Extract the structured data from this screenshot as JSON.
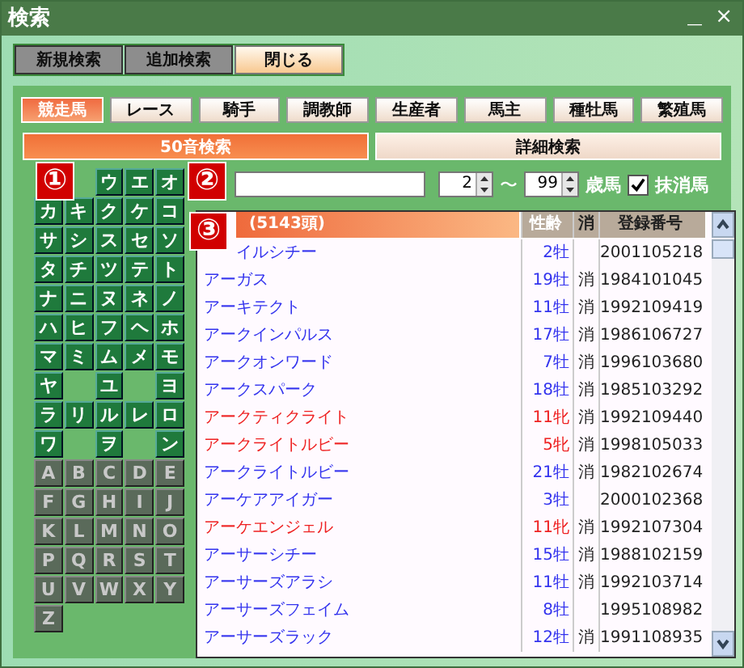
{
  "window": {
    "title": "検索",
    "controls": [
      "＿",
      "×"
    ]
  },
  "toolbar": [
    {
      "label": "新規検索",
      "selected": false
    },
    {
      "label": "追加検索",
      "selected": false
    },
    {
      "label": "閉じる",
      "selected": true
    }
  ],
  "tabs": [
    {
      "label": "競走馬",
      "selected": true
    },
    {
      "label": "レース",
      "selected": false
    },
    {
      "label": "騎手",
      "selected": false
    },
    {
      "label": "調教師",
      "selected": false
    },
    {
      "label": "生産者",
      "selected": false
    },
    {
      "label": "馬主",
      "selected": false
    },
    {
      "label": "種牡馬",
      "selected": false
    },
    {
      "label": "繁殖馬",
      "selected": false
    }
  ],
  "subtabs": [
    {
      "label": "50音検索",
      "selected": true
    },
    {
      "label": "詳細検索",
      "selected": false
    }
  ],
  "badges": [
    {
      "text": "①"
    },
    {
      "text": "②"
    },
    {
      "text": "③"
    }
  ],
  "kana_keys": [
    [
      {
        "kind": "covered"
      },
      {
        "kind": "covered"
      },
      {
        "kind": "kana",
        "label": "ウ"
      },
      {
        "kind": "kana",
        "label": "エ"
      },
      {
        "kind": "kana",
        "label": "オ"
      }
    ],
    [
      {
        "kind": "kana",
        "label": "カ"
      },
      {
        "kind": "kana",
        "label": "キ"
      },
      {
        "kind": "kana",
        "label": "ク"
      },
      {
        "kind": "kana",
        "label": "ケ"
      },
      {
        "kind": "kana",
        "label": "コ"
      }
    ],
    [
      {
        "kind": "kana",
        "label": "サ"
      },
      {
        "kind": "kana",
        "label": "シ"
      },
      {
        "kind": "kana",
        "label": "ス"
      },
      {
        "kind": "kana",
        "label": "セ"
      },
      {
        "kind": "kana",
        "label": "ソ"
      }
    ],
    [
      {
        "kind": "kana",
        "label": "タ"
      },
      {
        "kind": "kana",
        "label": "チ"
      },
      {
        "kind": "kana",
        "label": "ツ"
      },
      {
        "kind": "kana",
        "label": "テ"
      },
      {
        "kind": "kana",
        "label": "ト"
      }
    ],
    [
      {
        "kind": "kana",
        "label": "ナ"
      },
      {
        "kind": "kana",
        "label": "ニ"
      },
      {
        "kind": "kana",
        "label": "ヌ"
      },
      {
        "kind": "kana",
        "label": "ネ"
      },
      {
        "kind": "kana",
        "label": "ノ"
      }
    ],
    [
      {
        "kind": "kana",
        "label": "ハ"
      },
      {
        "kind": "kana",
        "label": "ヒ"
      },
      {
        "kind": "kana",
        "label": "フ"
      },
      {
        "kind": "kana",
        "label": "ヘ"
      },
      {
        "kind": "kana",
        "label": "ホ"
      }
    ],
    [
      {
        "kind": "kana",
        "label": "マ"
      },
      {
        "kind": "kana",
        "label": "ミ"
      },
      {
        "kind": "kana",
        "label": "ム"
      },
      {
        "kind": "kana",
        "label": "メ"
      },
      {
        "kind": "kana",
        "label": "モ"
      }
    ],
    [
      {
        "kind": "kana",
        "label": "ヤ"
      },
      {
        "kind": "gap"
      },
      {
        "kind": "kana",
        "label": "ユ"
      },
      {
        "kind": "gap"
      },
      {
        "kind": "kana",
        "label": "ヨ"
      }
    ],
    [
      {
        "kind": "kana",
        "label": "ラ"
      },
      {
        "kind": "kana",
        "label": "リ"
      },
      {
        "kind": "kana",
        "label": "ル"
      },
      {
        "kind": "kana",
        "label": "レ"
      },
      {
        "kind": "kana",
        "label": "ロ"
      }
    ],
    [
      {
        "kind": "kana",
        "label": "ワ"
      },
      {
        "kind": "gap"
      },
      {
        "kind": "kana",
        "label": "ヲ"
      },
      {
        "kind": "gap"
      },
      {
        "kind": "kana",
        "label": "ン"
      }
    ],
    [
      {
        "kind": "latin",
        "label": "A"
      },
      {
        "kind": "latin",
        "label": "B"
      },
      {
        "kind": "latin",
        "label": "C"
      },
      {
        "kind": "latin",
        "label": "D"
      },
      {
        "kind": "latin",
        "label": "E"
      }
    ],
    [
      {
        "kind": "latin",
        "label": "F"
      },
      {
        "kind": "latin",
        "label": "G"
      },
      {
        "kind": "latin",
        "label": "H"
      },
      {
        "kind": "latin",
        "label": "I"
      },
      {
        "kind": "latin",
        "label": "J"
      }
    ],
    [
      {
        "kind": "latin",
        "label": "K"
      },
      {
        "kind": "latin",
        "label": "L"
      },
      {
        "kind": "latin",
        "label": "M"
      },
      {
        "kind": "latin",
        "label": "N"
      },
      {
        "kind": "latin",
        "label": "O"
      }
    ],
    [
      {
        "kind": "latin",
        "label": "P"
      },
      {
        "kind": "latin",
        "label": "Q"
      },
      {
        "kind": "latin",
        "label": "R"
      },
      {
        "kind": "latin",
        "label": "S"
      },
      {
        "kind": "latin",
        "label": "T"
      }
    ],
    [
      {
        "kind": "latin",
        "label": "U"
      },
      {
        "kind": "latin",
        "label": "V"
      },
      {
        "kind": "latin",
        "label": "W"
      },
      {
        "kind": "latin",
        "label": "X"
      },
      {
        "kind": "latin",
        "label": "Y"
      }
    ],
    [
      {
        "kind": "latin",
        "label": "Z"
      }
    ]
  ],
  "filters": {
    "age_from": "2",
    "range_sign": "〜",
    "age_to": "99",
    "age_unit": "歳馬",
    "retired_checkbox": {
      "label": "抹消馬",
      "checked": true
    }
  },
  "table": {
    "columns": [
      "(5143頭)",
      "性齢",
      "消",
      "登録番号"
    ],
    "rows": [
      {
        "name": "イルシチー",
        "age_sex": "2牡",
        "reg_no": "2001105218",
        "color": "#3333ee"
      },
      {
        "name": "アーガス",
        "age_sex": "19牡",
        "retired": "消",
        "reg_no": "1984101045",
        "color": "#3333ee"
      },
      {
        "name": "アーキテクト",
        "age_sex": "11牡",
        "retired": "消",
        "reg_no": "1992109419",
        "color": "#3333ee"
      },
      {
        "name": "アークインパルス",
        "age_sex": "17牡",
        "retired": "消",
        "reg_no": "1986106727",
        "color": "#3333ee"
      },
      {
        "name": "アークオンワード",
        "age_sex": "7牡",
        "retired": "消",
        "reg_no": "1996103680",
        "color": "#3333ee"
      },
      {
        "name": "アークスパーク",
        "age_sex": "18牡",
        "retired": "消",
        "reg_no": "1985103292",
        "color": "#3333ee"
      },
      {
        "name": "アークティクライト",
        "age_sex": "11牝",
        "retired": "消",
        "reg_no": "1992109440",
        "color": "#ee2222"
      },
      {
        "name": "アークライトルビー",
        "age_sex": "5牝",
        "retired": "消",
        "reg_no": "1998105033",
        "color": "#ee2222"
      },
      {
        "name": "アークライトルビー",
        "age_sex": "21牡",
        "retired": "消",
        "reg_no": "1982102674",
        "color": "#3333ee"
      },
      {
        "name": "アーケアアイガー",
        "age_sex": "3牡",
        "reg_no": "2000102368",
        "color": "#3333ee"
      },
      {
        "name": "アーケエンジェル",
        "age_sex": "11牝",
        "retired": "消",
        "reg_no": "1992107304",
        "color": "#ee2222"
      },
      {
        "name": "アーサーシチー",
        "age_sex": "15牡",
        "retired": "消",
        "reg_no": "1988102159",
        "color": "#3333ee"
      },
      {
        "name": "アーサーズアラシ",
        "age_sex": "11牡",
        "retired": "消",
        "reg_no": "1992103714",
        "color": "#3333ee"
      },
      {
        "name": "アーサーズフェイム",
        "age_sex": "8牡",
        "reg_no": "1995108982",
        "color": "#3333ee"
      },
      {
        "name": "アーサーズラック",
        "age_sex": "12牡",
        "retired": "消",
        "reg_no": "1991108935",
        "color": "#3333ee"
      }
    ]
  }
}
